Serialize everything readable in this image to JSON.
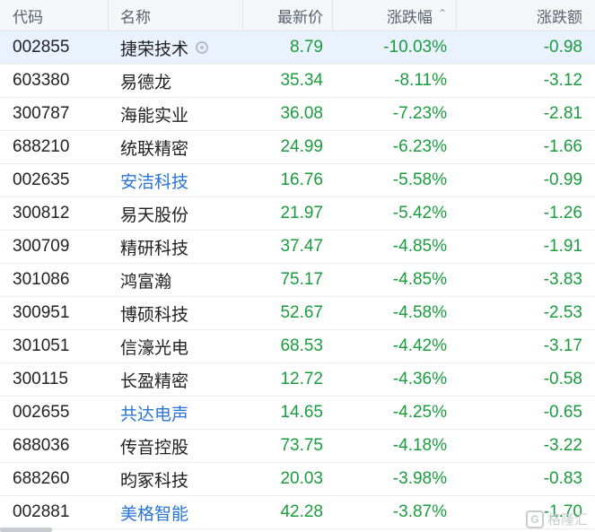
{
  "header": {
    "code": "代码",
    "name": "名称",
    "price": "最新价",
    "pct": "涨跌幅",
    "sort_icon": "sort-up-icon",
    "chg": "涨跌额"
  },
  "colors": {
    "down": "#1a9c3e",
    "link_name": "#2a74d6",
    "selected_row": "#eaf2fe"
  },
  "rows": [
    {
      "code": "002855",
      "name": "捷荣技术",
      "price": "8.79",
      "pct": "-10.03%",
      "chg": "-0.98",
      "selected": true,
      "watch_icon": "eye-icon"
    },
    {
      "code": "603380",
      "name": "易德龙",
      "price": "35.34",
      "pct": "-8.11%",
      "chg": "-3.12"
    },
    {
      "code": "300787",
      "name": "海能实业",
      "price": "36.08",
      "pct": "-7.23%",
      "chg": "-2.81"
    },
    {
      "code": "688210",
      "name": "统联精密",
      "price": "24.99",
      "pct": "-6.23%",
      "chg": "-1.66"
    },
    {
      "code": "002635",
      "name": "安洁科技",
      "price": "16.76",
      "pct": "-5.58%",
      "chg": "-0.99",
      "link": true
    },
    {
      "code": "300812",
      "name": "易天股份",
      "price": "21.97",
      "pct": "-5.42%",
      "chg": "-1.26"
    },
    {
      "code": "300709",
      "name": "精研科技",
      "price": "37.47",
      "pct": "-4.85%",
      "chg": "-1.91"
    },
    {
      "code": "301086",
      "name": "鸿富瀚",
      "price": "75.17",
      "pct": "-4.85%",
      "chg": "-3.83"
    },
    {
      "code": "300951",
      "name": "博硕科技",
      "price": "52.67",
      "pct": "-4.58%",
      "chg": "-2.53"
    },
    {
      "code": "301051",
      "name": "信濠光电",
      "price": "68.53",
      "pct": "-4.42%",
      "chg": "-3.17"
    },
    {
      "code": "300115",
      "name": "长盈精密",
      "price": "12.72",
      "pct": "-4.36%",
      "chg": "-0.58"
    },
    {
      "code": "002655",
      "name": "共达电声",
      "price": "14.65",
      "pct": "-4.25%",
      "chg": "-0.65",
      "link": true
    },
    {
      "code": "688036",
      "name": "传音控股",
      "price": "73.75",
      "pct": "-4.18%",
      "chg": "-3.22"
    },
    {
      "code": "688260",
      "name": "昀冢科技",
      "price": "20.03",
      "pct": "-3.98%",
      "chg": "-0.83"
    },
    {
      "code": "002881",
      "name": "美格智能",
      "price": "42.28",
      "pct": "-3.87%",
      "chg": "-1.70",
      "link": true
    }
  ],
  "watermark": {
    "badge": "G",
    "text": "格隆汇"
  }
}
